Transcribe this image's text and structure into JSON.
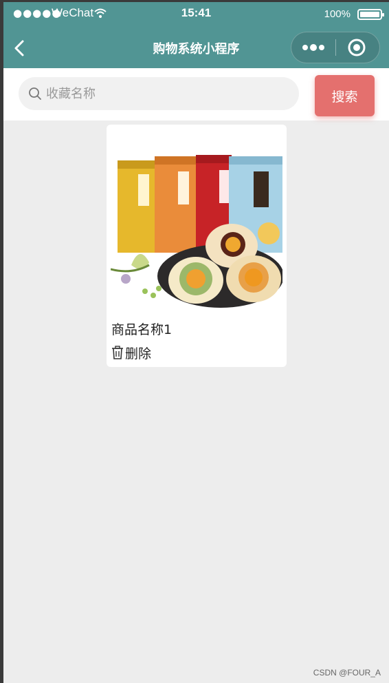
{
  "status_bar": {
    "signal": "●●●●●",
    "carrier": "WeChat",
    "time": "15:41",
    "battery": "100%"
  },
  "nav": {
    "title": "购物系统小程序",
    "icons": {
      "back": "chevron-left-icon",
      "more": "more-dots-icon",
      "close": "record-circle-icon"
    }
  },
  "search": {
    "placeholder": "收藏名称",
    "value": "",
    "button_label": "搜索",
    "icon": "search-icon"
  },
  "favorites": [
    {
      "name": "商品名称1",
      "image": "mooncake-product-image",
      "delete_label": "删除",
      "delete_icon": "trash-icon"
    }
  ],
  "watermark": "CSDN @FOUR_A",
  "colors": {
    "nav_background": "#519594",
    "search_button": "#e4706e",
    "page_background": "#ededed"
  }
}
